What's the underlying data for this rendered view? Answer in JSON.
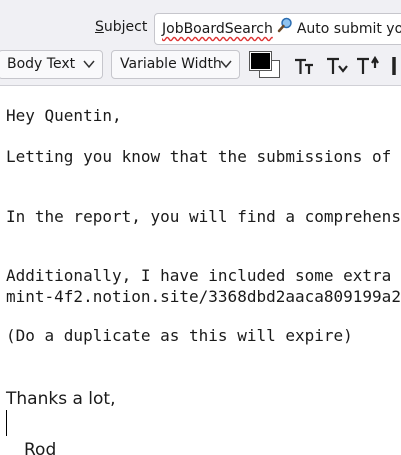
{
  "subject": {
    "label": "Subject",
    "value_part1": "JobBoardSearch",
    "value_part2": "Auto submit you"
  },
  "toolbar": {
    "paragraph_style": "Body Text",
    "font_family": "Variable Width"
  },
  "email": {
    "greeting": "Hey Quentin,",
    "line1": "Letting you know that the submissions of j",
    "line2": "In the report, you will find a comprehens",
    "line3": "Additionally, I have included some extra",
    "line4": "mint-4f2.notion.site/3368dbd2aaca809199a2",
    "line5": "(Do a duplicate as this will expire)",
    "signoff": "Thanks a lot,",
    "signature": "Rod"
  }
}
